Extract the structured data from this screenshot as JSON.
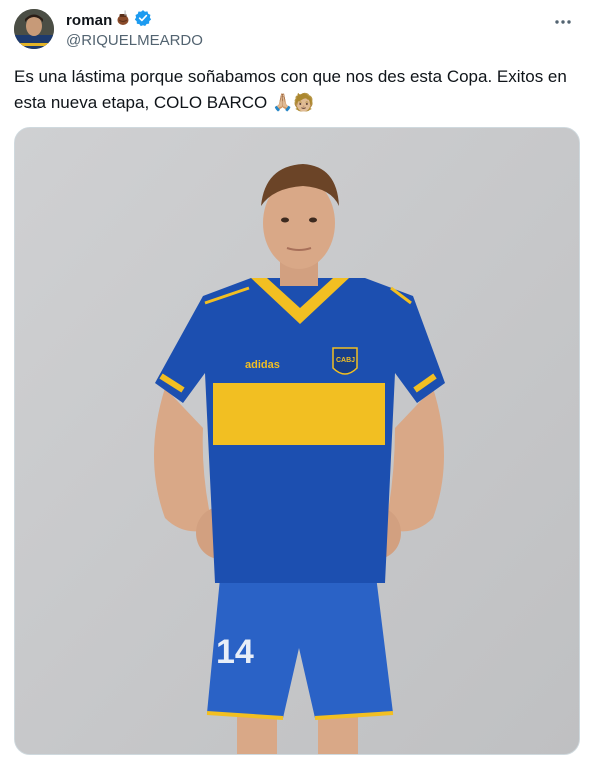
{
  "author": {
    "display_name": "roman",
    "handle": "@RIQUELMEARDO",
    "verified_color": "#1d9bf0",
    "name_emoji_icon": "mate-gourd-icon",
    "avatar_icon": "avatar-photo-icon"
  },
  "tweet": {
    "text": "Es una lástima porque soñabamos con que nos des esta Copa. Exitos en esta nueva etapa, COLO BARCO 🙏🏼🧑🏼",
    "more_icon": "more-options-icon"
  },
  "media": {
    "jersey_number": "14",
    "brand_text": "adidas",
    "crest_text": "CABJ",
    "colors": {
      "background": "#c6c7c9",
      "blue": "#1c4fb0",
      "yellow": "#f2bf22",
      "skin": "#d9a887",
      "hair": "#6b4427"
    }
  }
}
